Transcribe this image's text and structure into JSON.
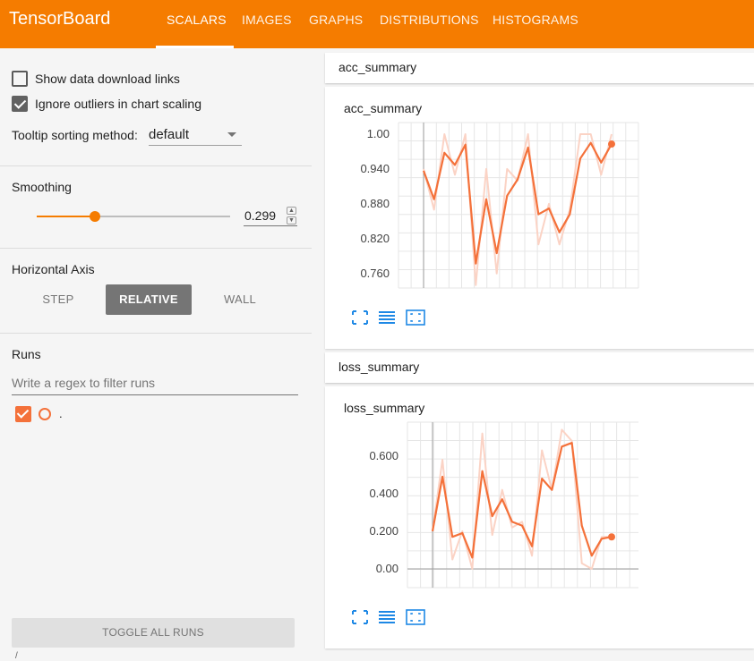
{
  "app": {
    "title": "TensorBoard",
    "tabs": [
      {
        "label": "SCALARS",
        "active": true
      },
      {
        "label": "IMAGES",
        "active": false
      },
      {
        "label": "GRAPHS",
        "active": false
      },
      {
        "label": "DISTRIBUTIONS",
        "active": false
      },
      {
        "label": "HISTOGRAMS",
        "active": false
      }
    ],
    "accent_color": "#f57c00"
  },
  "sidebar": {
    "show_download_label": "Show data download links",
    "show_download_checked": false,
    "ignore_outliers_label": "Ignore outliers in chart scaling",
    "ignore_outliers_checked": true,
    "tooltip_label": "Tooltip sorting method:",
    "tooltip_value": "default",
    "smoothing_title": "Smoothing",
    "smoothing_value": "0.299",
    "smoothing_fraction": 0.299,
    "horizontal_axis_title": "Horizontal Axis",
    "axis_options": [
      "STEP",
      "RELATIVE",
      "WALL"
    ],
    "axis_selected": "RELATIVE",
    "runs_title": "Runs",
    "filter_placeholder": "Write a regex to filter runs",
    "runs": [
      {
        "name": ".",
        "checked": true,
        "color": "#f4713a"
      }
    ],
    "toggle_all_label": "TOGGLE ALL RUNS",
    "footer_text": "/"
  },
  "cards": [
    {
      "header": "acc_summary",
      "title": "acc_summary",
      "icons": [
        "fullscreen-icon",
        "list-icon",
        "fit-domain-icon"
      ]
    },
    {
      "header": "loss_summary",
      "title": "loss_summary",
      "icons": [
        "fullscreen-icon",
        "list-icon",
        "fit-domain-icon"
      ]
    }
  ],
  "chart_data": [
    {
      "type": "line",
      "title": "acc_summary",
      "xlabel": "",
      "ylabel": "",
      "y_ticks": [
        "1.00",
        "0.940",
        "0.880",
        "0.820",
        "0.760"
      ],
      "ylim": [
        0.735,
        1.02
      ],
      "grid": true,
      "series": [
        {
          "role": "raw",
          "color": "#fbd3c5",
          "values": [
            0.94,
            0.87,
            1.0,
            0.93,
            1.0,
            0.74,
            0.94,
            0.76,
            0.94,
            0.92,
            1.0,
            0.81,
            0.88,
            0.81,
            0.87,
            1.0,
            1.0,
            0.93,
            1.0
          ]
        },
        {
          "role": "smoothed",
          "color": "#f4713a",
          "values": [
            0.937,
            0.888,
            0.968,
            0.947,
            0.982,
            0.777,
            0.888,
            0.795,
            0.894,
            0.922,
            0.977,
            0.862,
            0.872,
            0.831,
            0.862,
            0.958,
            0.985,
            0.951,
            0.983
          ]
        }
      ]
    },
    {
      "type": "line",
      "title": "loss_summary",
      "xlabel": "",
      "ylabel": "",
      "y_ticks": [
        "0.600",
        "0.400",
        "0.200",
        "0.00"
      ],
      "ylim": [
        -0.1,
        0.78
      ],
      "grid": true,
      "series": [
        {
          "role": "raw",
          "color": "#fbd3c5",
          "values": [
            0.2,
            0.58,
            0.05,
            0.2,
            0.0,
            0.72,
            0.18,
            0.42,
            0.22,
            0.25,
            0.07,
            0.63,
            0.42,
            0.74,
            0.68,
            0.03,
            0.0,
            0.17,
            0.17
          ]
        },
        {
          "role": "smoothed",
          "color": "#f4713a",
          "values": [
            0.2,
            0.49,
            0.17,
            0.19,
            0.06,
            0.52,
            0.28,
            0.37,
            0.25,
            0.23,
            0.12,
            0.48,
            0.42,
            0.65,
            0.67,
            0.23,
            0.07,
            0.16,
            0.17
          ]
        }
      ]
    }
  ]
}
